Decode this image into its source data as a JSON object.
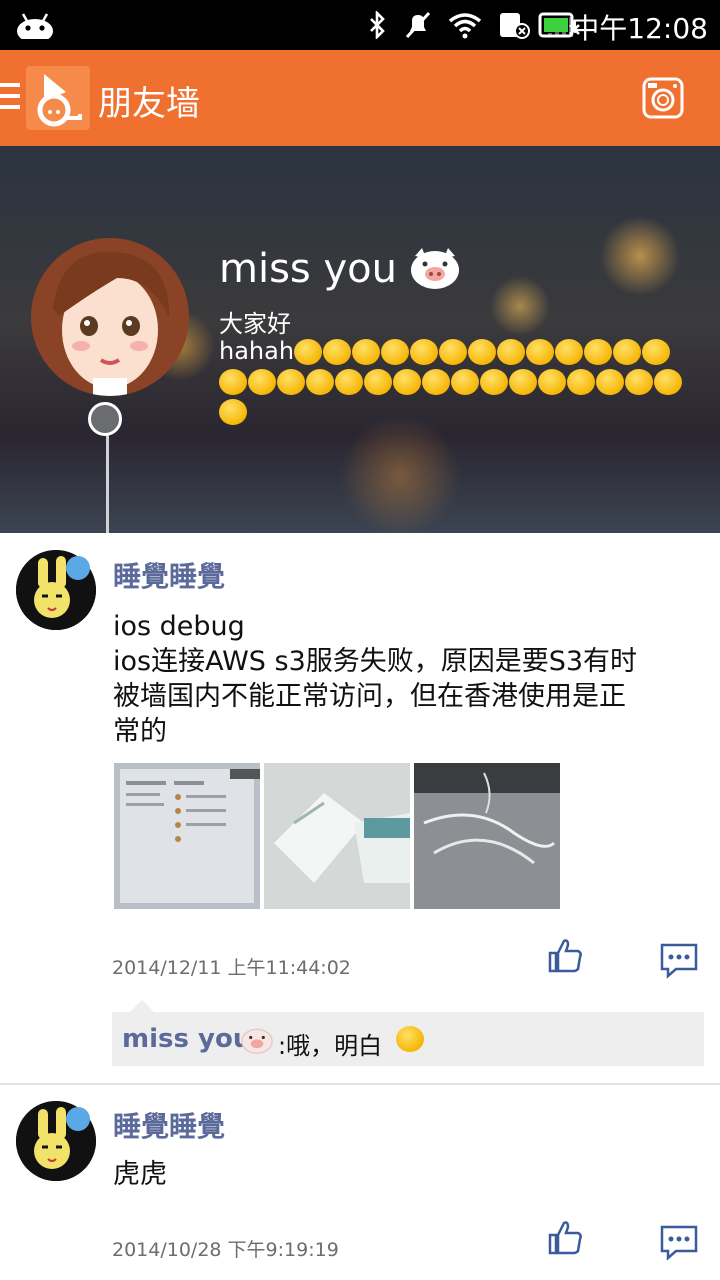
{
  "status_bar": {
    "time": "中午12:08"
  },
  "app_bar": {
    "title": "朋友墙"
  },
  "cover": {
    "name": "miss you",
    "bio_line1": "大家好",
    "bio_line2": "hahah"
  },
  "posts": [
    {
      "author": "睡覺睡覺",
      "text_line1": "ios debug",
      "text_line2": "ios连接AWS s3服务失败，原因是要S3有时",
      "text_line3": "被墙国内不能正常访问，但在香港使用是正",
      "text_line4": "常的",
      "timestamp": "2014/12/11 上午11:44:02",
      "comment": {
        "author": "miss you",
        "text": ":哦，明白"
      }
    },
    {
      "author": "睡覺睡覺",
      "text_line1": "虎虎",
      "timestamp": "2014/10/28 下午9:19:19"
    }
  ]
}
